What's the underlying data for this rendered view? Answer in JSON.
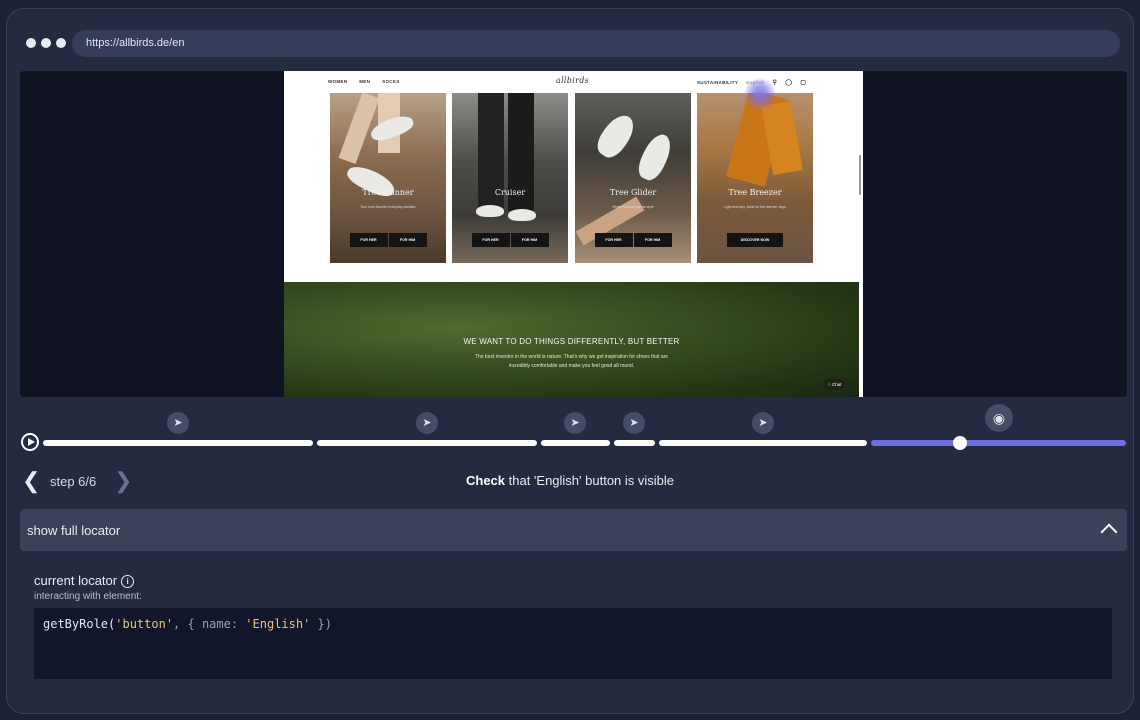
{
  "browser": {
    "url": "https://allbirds.de/en"
  },
  "site": {
    "nav_left": [
      "WOMEN",
      "MEN",
      "SOCKS"
    ],
    "logo": "allbirds",
    "nav_right_link": "SUSTAINABILITY",
    "language": "English",
    "products": [
      {
        "title": "Tree Runner",
        "subtitle": "Your new favorite everyday sneaker",
        "buttons": [
          "FOR HER",
          "FOR HIM"
        ]
      },
      {
        "title": "Cruiser",
        "subtitle": "",
        "buttons": [
          "FOR HER",
          "FOR HIM"
        ]
      },
      {
        "title": "Tree Glider",
        "subtitle": "Where comfort meets style",
        "buttons": [
          "FOR HER",
          "FOR HIM"
        ]
      },
      {
        "title": "Tree Breezer",
        "subtitle": "Light and airy, ideal for the warmer days",
        "buttons": [
          "DISCOVER NOW"
        ]
      }
    ],
    "hero_heading": "WE WANT TO DO THINGS DIFFERENTLY, BUT BETTER",
    "hero_text_line1": "The best inventor in the world is nature. That's why we get inspiration for shoes that are",
    "hero_text_line2": "incredibly comfortable and make you feel good all round.",
    "chat_label": "Chat"
  },
  "player": {
    "step_label": "step 6/6",
    "action_verb": "Check",
    "action_rest": " that 'English' button is visible",
    "steps_total": 6,
    "current_step": 6
  },
  "locator": {
    "toggle_label": "show full locator",
    "current_label": "current locator",
    "info_glyph": "i",
    "interacting_label": "interacting with element:",
    "code_fn": "getByRole(",
    "code_arg1": "'button'",
    "code_mid": ", { name: ",
    "code_arg2": "'English'",
    "code_end": " })"
  },
  "colors": {
    "background": "#1c2136",
    "panel": "#242a40",
    "accent": "#6d6fe0",
    "code_bg": "#12162a"
  },
  "icons": {
    "step_marker": "cursor-click-icon",
    "final_marker": "eye-icon",
    "play": "play-icon",
    "prev": "chevron-left-icon",
    "next": "chevron-right-icon",
    "collapse": "chevron-up-icon",
    "info": "info-icon"
  }
}
